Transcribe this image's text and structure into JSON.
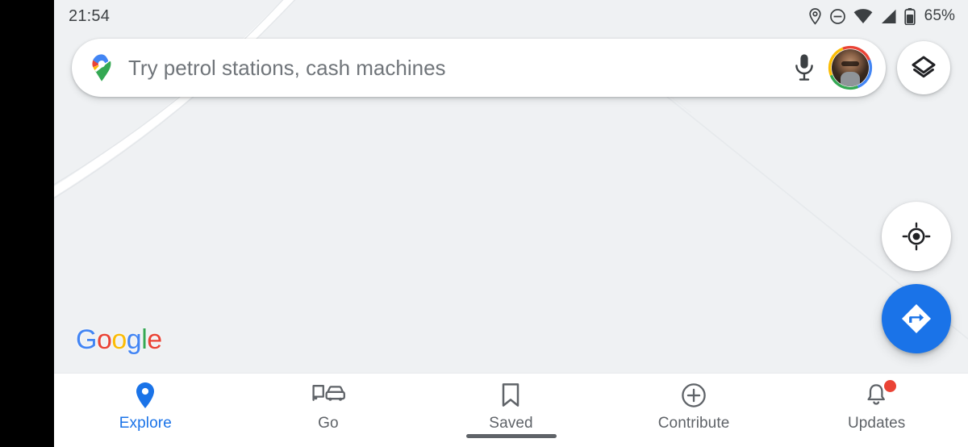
{
  "app": {
    "name": "Google Maps",
    "watermark": "Google",
    "watermark_letters": [
      {
        "char": "G",
        "color": "#4285f4"
      },
      {
        "char": "o",
        "color": "#ea4335"
      },
      {
        "char": "o",
        "color": "#fbbc05"
      },
      {
        "char": "g",
        "color": "#4285f4"
      },
      {
        "char": "l",
        "color": "#34a853"
      },
      {
        "char": "e",
        "color": "#ea4335"
      }
    ]
  },
  "status_bar": {
    "clock": "21:54",
    "battery_percent": "65%",
    "icons": [
      "location-icon",
      "do-not-disturb-icon",
      "wifi-icon",
      "cellular-signal-icon",
      "battery-icon"
    ]
  },
  "search": {
    "placeholder": "Try petrol stations, cash machines",
    "value": "",
    "leading_icon": "google-maps-pin-icon",
    "mic_icon": "microphone-icon",
    "avatar_icon": "account-avatar"
  },
  "map_controls": {
    "layers_label": "Layers",
    "layers_icon": "layers-icon",
    "my_location_label": "My location",
    "my_location_icon": "my-location-crosshair-icon",
    "directions_label": "Directions",
    "directions_icon": "directions-arrow-icon"
  },
  "bottom_nav": {
    "active_index": 0,
    "items": [
      {
        "label": "Explore",
        "icon": "map-pin-icon",
        "badge": false
      },
      {
        "label": "Go",
        "icon": "commute-bus-car-icon",
        "badge": false
      },
      {
        "label": "Saved",
        "icon": "bookmark-icon",
        "badge": false
      },
      {
        "label": "Contribute",
        "icon": "plus-circle-icon",
        "badge": false
      },
      {
        "label": "Updates",
        "icon": "bell-icon",
        "badge": true
      }
    ]
  },
  "colors": {
    "accent_blue": "#1a73e8",
    "map_background": "#eff1f3",
    "badge_red": "#ea4335",
    "text_secondary": "#5f6368"
  }
}
